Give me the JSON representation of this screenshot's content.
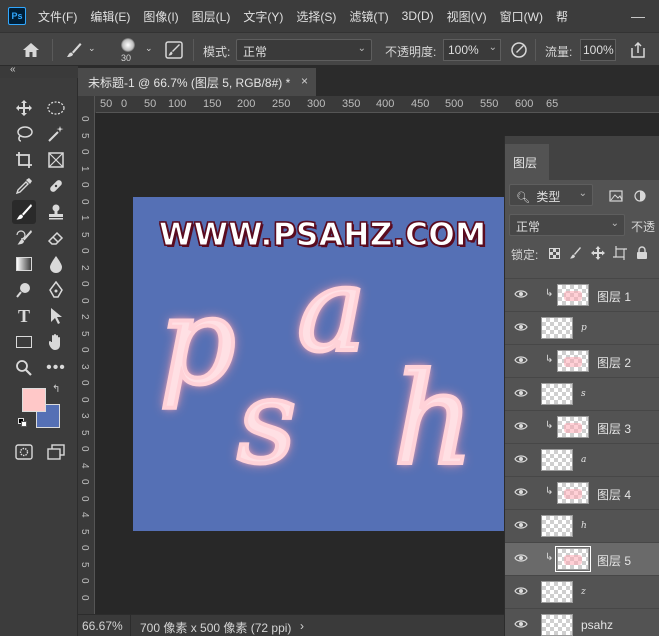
{
  "app": {
    "logo_text": "Ps"
  },
  "menu": [
    "文件(F)",
    "编辑(E)",
    "图像(I)",
    "图层(L)",
    "文字(Y)",
    "选择(S)",
    "滤镜(T)",
    "3D(D)",
    "视图(V)",
    "窗口(W)",
    "帮"
  ],
  "window_controls": {
    "minimize": "—"
  },
  "options_bar": {
    "brush_size": "30",
    "mode_label": "模式:",
    "mode_value": "正常",
    "opacity_label": "不透明度:",
    "opacity_value": "100%",
    "flow_label": "流量:",
    "flow_value": "100%"
  },
  "document": {
    "tab_title": "未标题-1 @ 66.7% (图层 5, RGB/8#) *"
  },
  "ruler": {
    "h_ticks": [
      "50",
      "0",
      "50",
      "100",
      "150",
      "200",
      "250",
      "300",
      "350",
      "400",
      "450",
      "500",
      "550",
      "600",
      "65"
    ],
    "v_ticks": [
      "0",
      "5",
      "0",
      "1",
      "0",
      "0",
      "1",
      "5",
      "0",
      "2",
      "0",
      "0",
      "2",
      "5",
      "0",
      "3",
      "0",
      "0",
      "3",
      "5",
      "0",
      "4",
      "0",
      "0",
      "4",
      "5",
      "0",
      "5",
      "0",
      "0"
    ]
  },
  "canvas": {
    "watermark": "WWW.PSAHZ.COM",
    "background_color": "#5570b5",
    "letters": [
      "p",
      "a",
      "s",
      "h"
    ]
  },
  "colors": {
    "foreground": "#ffc8c8",
    "background": "#5570b5"
  },
  "status": {
    "zoom": "66.67%",
    "doc_info": "700 像素 x 500 像素 (72 ppi)",
    "arrow": "›"
  },
  "layers_panel": {
    "tab_label": "图层",
    "filter_label": "类型",
    "blend_mode": "正常",
    "opacity_label": "不透",
    "lock_label": "锁定:",
    "layers": [
      {
        "name": "图层 1",
        "type": "clip",
        "selected": false
      },
      {
        "name": "p",
        "type": "text",
        "selected": false
      },
      {
        "name": "图层 2",
        "type": "clip",
        "selected": false
      },
      {
        "name": "s",
        "type": "text",
        "selected": false
      },
      {
        "name": "图层 3",
        "type": "clip",
        "selected": false
      },
      {
        "name": "a",
        "type": "text",
        "selected": false
      },
      {
        "name": "图层 4",
        "type": "clip",
        "selected": false
      },
      {
        "name": "h",
        "type": "text",
        "selected": false
      },
      {
        "name": "图层 5",
        "type": "clip",
        "selected": true
      },
      {
        "name": "z",
        "type": "text",
        "selected": false
      },
      {
        "name": "psahz",
        "type": "text",
        "selected": false
      }
    ]
  }
}
